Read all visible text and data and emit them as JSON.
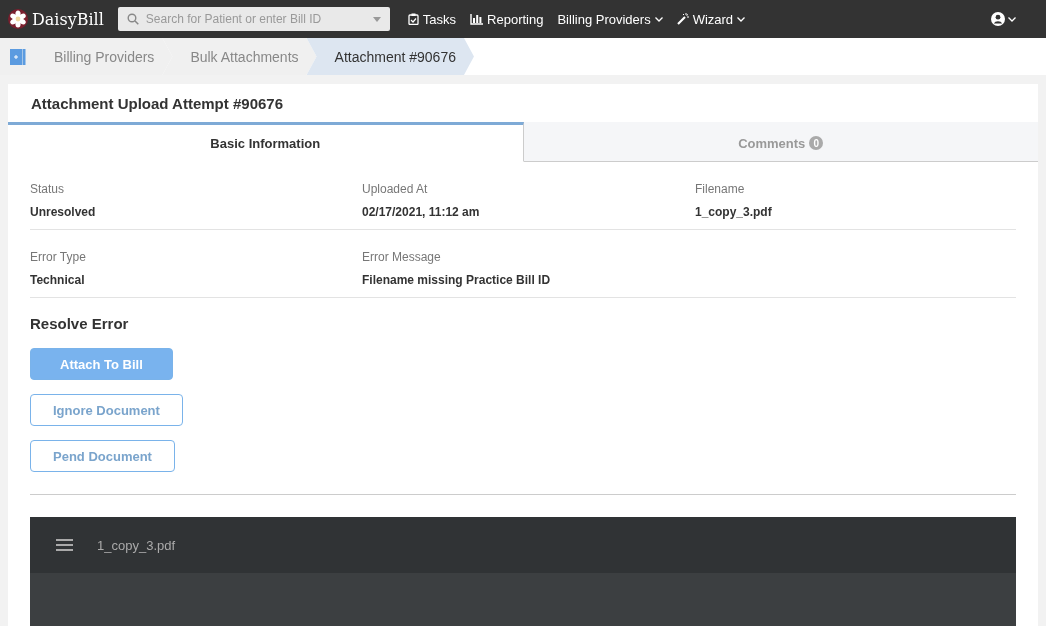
{
  "navbar": {
    "brand": "DaisyBill",
    "search": {
      "placeholder": "Search for Patient or enter Bill ID"
    },
    "items": [
      {
        "label": "Tasks",
        "dropdown": false
      },
      {
        "label": "Reporting",
        "dropdown": false
      },
      {
        "label": "Billing Providers",
        "dropdown": true
      },
      {
        "label": "Wizard",
        "dropdown": true
      }
    ]
  },
  "breadcrumbs": [
    {
      "label": "Billing Providers",
      "selected": false
    },
    {
      "label": "Bulk Attachments",
      "selected": false
    },
    {
      "label": "Attachment #90676",
      "selected": true
    }
  ],
  "card": {
    "title": "Attachment Upload Attempt #90676",
    "tabs": [
      {
        "label": "Basic Information",
        "selected": true
      },
      {
        "label": "Comments",
        "selected": false,
        "badge": "0"
      }
    ],
    "field_rows": [
      [
        {
          "label": "Status",
          "value": "Unresolved"
        },
        {
          "label": "Uploaded At",
          "value": "02/17/2021, 11:12 am"
        },
        {
          "label": "Filename",
          "value": "1_copy_3.pdf"
        }
      ],
      [
        {
          "label": "Error Type",
          "value": "Technical"
        },
        {
          "label": "Error Message",
          "value": "Filename missing Practice Bill ID"
        }
      ]
    ],
    "resolve": {
      "heading": "Resolve Error",
      "buttons": [
        {
          "label": "Attach To Bill",
          "kind": "primary"
        },
        {
          "label": "Ignore Document",
          "kind": "outline"
        },
        {
          "label": "Pend Document",
          "kind": "outline"
        }
      ]
    },
    "viewer": {
      "filename": "1_copy_3.pdf"
    }
  }
}
